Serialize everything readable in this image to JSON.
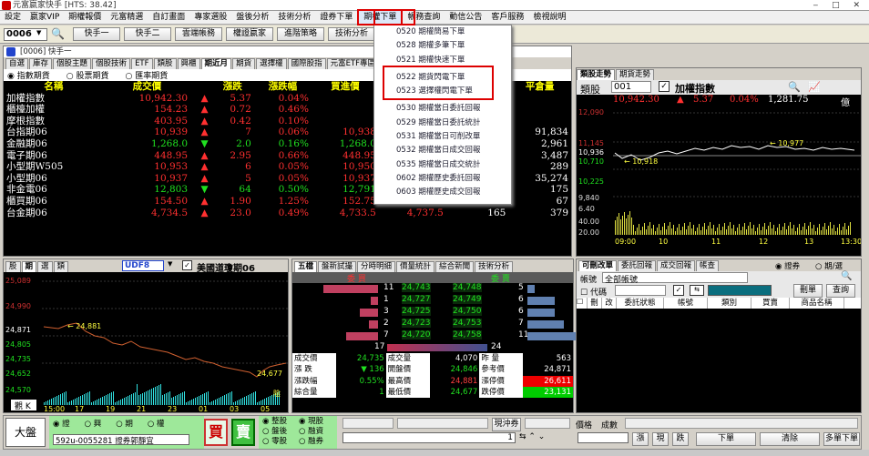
{
  "app": {
    "title": "元富嬴家快手 [HTS: 38.42]"
  },
  "menubar": [
    "設定",
    "嬴家VIP",
    "期權報價",
    "元富精選",
    "自訂畫面",
    "專家選股",
    "盤後分析",
    "技術分析",
    "證券下單",
    "期權下單",
    "帳務查詢",
    "動信公告",
    "客戶服務",
    "檢視說明"
  ],
  "toolbar": {
    "code": "0006",
    "buttons": [
      "快手一",
      "快手二",
      "雲端帳務",
      "權證嬴家",
      "進階策略",
      "技術分析"
    ]
  },
  "dropdown": {
    "items": [
      "0520 期權簡易下單",
      "0528 期權多筆下單",
      "0521 期權快速下單",
      "0522 期貨閃電下單",
      "0523 選擇權閃電下單",
      "0530 期權當日委託回報",
      "0529 期權當日委託統計",
      "0531 期權當日可削改單",
      "0532 期權當日成交回報",
      "0535 期權當日成交統計",
      "0602 期權歷史委託回報",
      "0603 期權歷史成交回報"
    ]
  },
  "main_window": {
    "title": "[0006] 快手一",
    "tabs": [
      "自選",
      "庫存",
      "個股主題",
      "個股技術",
      "ETF",
      "類股",
      "興櫃",
      "期近月",
      "期貨",
      "選擇權",
      "國際股指",
      "元富ETF專區"
    ],
    "radios": [
      "指數期貨",
      "股票期貨",
      "匯率期貨"
    ],
    "headers": [
      "名稱",
      "成交價",
      "漲跌",
      "漲跌幅",
      "買進價",
      "賣出",
      "",
      "平倉量"
    ],
    "rows": [
      {
        "name": "加權指數",
        "price": "10,942.30",
        "arrow": "▲",
        "chg": "5.37",
        "pct": "0.04%",
        "bid": "",
        "ask": "",
        "vol": "",
        "oi": "",
        "c": "r"
      },
      {
        "name": "櫃檯加權",
        "price": "154.23",
        "arrow": "▲",
        "chg": "0.72",
        "pct": "0.46%",
        "bid": "",
        "ask": "",
        "vol": "",
        "oi": "",
        "c": "r"
      },
      {
        "name": "摩根指數",
        "price": "403.95",
        "arrow": "▲",
        "chg": "0.42",
        "pct": "0.10%",
        "bid": "",
        "ask": "",
        "vol": "",
        "oi": "",
        "c": "r"
      },
      {
        "name": "台指期06",
        "price": "10,939",
        "arrow": "▲",
        "chg": "7",
        "pct": "0.06%",
        "bid": "10,938",
        "ask": "",
        "vol": "",
        "oi": "91,834",
        "c": "r"
      },
      {
        "name": "金融期06",
        "price": "1,268.0",
        "arrow": "▼",
        "chg": "2.0",
        "pct": "0.16%",
        "bid": "1,268.0",
        "ask": "",
        "vol": "",
        "oi": "2,961",
        "c": "g"
      },
      {
        "name": "電子期06",
        "price": "448.95",
        "arrow": "▲",
        "chg": "2.95",
        "pct": "0.66%",
        "bid": "448.95",
        "ask": "",
        "vol": "",
        "oi": "3,487",
        "c": "r"
      },
      {
        "name": "小型期W505",
        "price": "10,953",
        "arrow": "▲",
        "chg": "6",
        "pct": "0.05%",
        "bid": "10,950",
        "ask": "",
        "vol": "",
        "oi": "289",
        "c": "r"
      },
      {
        "name": "小型期06",
        "price": "10,937",
        "arrow": "▲",
        "chg": "5",
        "pct": "0.05%",
        "bid": "10,937",
        "ask": "10,939",
        "vol": "18,359",
        "oi": "35,274",
        "c": "r"
      },
      {
        "name": "非金電06",
        "price": "12,803",
        "arrow": "▼",
        "chg": "64",
        "pct": "0.50%",
        "bid": "12,791",
        "ask": "12,806",
        "vol": "223",
        "oi": "175",
        "c": "g"
      },
      {
        "name": "櫃買期06",
        "price": "154.50",
        "arrow": "▲",
        "chg": "1.90",
        "pct": "1.25%",
        "bid": "152.75",
        "ask": "154.65",
        "vol": "5",
        "oi": "67",
        "c": "r"
      },
      {
        "name": "台金期06",
        "price": "4,734.5",
        "arrow": "▲",
        "chg": "23.0",
        "pct": "0.49%",
        "bid": "4,733.5",
        "ask": "4,737.5",
        "vol": "165",
        "oi": "379",
        "c": "r"
      }
    ]
  },
  "index_panel": {
    "tabs": [
      "類股走勢",
      "期貨走勢"
    ],
    "code": "001",
    "name": "加權指數",
    "price": "10,942.30",
    "chg": "5.37",
    "pct": "0.04%",
    "vol": "1,281.75",
    "unit": "億",
    "y_top": [
      "12,090",
      "11,145",
      "10,936",
      "10,710",
      "10,225",
      "9,840",
      "6.40",
      "40.00",
      "20.00"
    ],
    "mark_high": "10,977",
    "mark_low": "10,918",
    "x_ticks": [
      "09:00",
      "10",
      "11",
      "12",
      "13",
      "13:30"
    ]
  },
  "futures_chart": {
    "tabs": [
      "股",
      "期",
      "選",
      "類"
    ],
    "code": "UDF8",
    "name": "美國道瓊期06",
    "y": [
      "25,089",
      "24,990",
      "24,871",
      "24,805",
      "24,735",
      "24,652",
      "24,570"
    ],
    "mark_high": "24,881",
    "mark_low": "24,677",
    "x": [
      "15:00",
      "17",
      "19",
      "21",
      "23",
      "01",
      "03",
      "05"
    ],
    "unit_label": "陰",
    "left_label": "觀 K"
  },
  "five_levels": {
    "tabs": [
      "五檔",
      "盤新試撮",
      "分時明細",
      "價量統計",
      "綜合新聞",
      "技術分析"
    ],
    "head_buy": "委  買",
    "head_sell": "委  賣",
    "bids": [
      [
        "11",
        "24,743"
      ],
      [
        "1",
        "24,727"
      ],
      [
        "3",
        "24,725"
      ],
      [
        "2",
        "24,723"
      ],
      [
        "7",
        "24,720"
      ]
    ],
    "asks": [
      [
        "24,748",
        "5"
      ],
      [
        "24,749",
        "6"
      ],
      [
        "24,750",
        "6"
      ],
      [
        "24,753",
        "7"
      ],
      [
        "24,758",
        "11"
      ]
    ],
    "tot_bid": "17",
    "tot_ask": "24",
    "stats": [
      [
        "成交價",
        "24,735",
        "成交量",
        "4,070",
        "昨  量",
        "563"
      ],
      [
        "漲  跌",
        "▼ 136",
        "開盤價",
        "24,846",
        "參考價",
        "24,871"
      ],
      [
        "漲跌幅",
        "0.55%",
        "最高價",
        "24,881",
        "漲停價",
        "26,611"
      ],
      [
        "綜合量",
        "1",
        "最低價",
        "24,677",
        "跌停價",
        "23,131"
      ]
    ]
  },
  "order_panel": {
    "tabs": [
      "可刪改單",
      "委託回報",
      "成交回報",
      "帳查"
    ],
    "radios": [
      "證券",
      "期/選"
    ],
    "account_label": "帳號",
    "account_value": "全部帳號",
    "code_label": "代碼",
    "buttons": [
      "刪單",
      "查詢"
    ],
    "cols": [
      "刪",
      "改",
      "委託狀態",
      "帳號",
      "類別",
      "買賣",
      "商品名稱"
    ]
  },
  "bottom": {
    "big_label": "大盤",
    "radios": [
      "證",
      "興",
      "期",
      "權"
    ],
    "account": "592u-0055281 證券郭靜宜",
    "buy": "買",
    "sell": "賣",
    "options1": [
      "整股",
      "盤後",
      "零股"
    ],
    "options2": [
      "現股",
      "融資",
      "融券"
    ],
    "cash_label": "現沖券",
    "price_label": "價格",
    "qty_label": "成數",
    "qty_value": "1",
    "buttons": [
      "漲",
      "現",
      "跌",
      "下單",
      "清除",
      "多單下單"
    ]
  }
}
